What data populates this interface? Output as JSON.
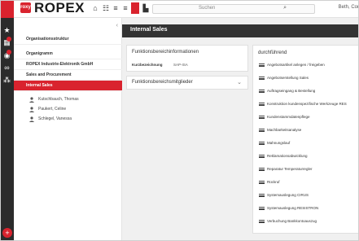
{
  "topbar": {
    "logo_badge": "roxy",
    "logo_text": "ROPEX",
    "icons": [
      "home-icon",
      "list-icon",
      "menu-icon",
      "menu-icon",
      "org-icon",
      "chart-icon"
    ],
    "search_placeholder": "Suchen",
    "user_name": "Beth, Cor"
  },
  "rail": {
    "icons": [
      "star-icon",
      "grid-icon",
      "people-icon",
      "infinity-icon",
      "network-icon"
    ],
    "add_label": "+"
  },
  "nav": {
    "items": [
      {
        "label": "Organisationsstruktur",
        "active": false
      },
      {
        "label": "Organigramm",
        "active": false
      },
      {
        "label": "ROPEX Industrie-Elektronik GmbH",
        "active": false
      },
      {
        "label": "Sales and Procurement",
        "active": false
      },
      {
        "label": "Internal Sales",
        "active": true
      }
    ],
    "people": [
      "Kutschbauch, Thomas",
      "Paukert, Celine",
      "Schlegel, Vanessa"
    ]
  },
  "main": {
    "title": "Internal Sales",
    "info_card": {
      "title": "Funktionsbereichinformationen",
      "label": "Kurzbezeichnung",
      "value": "SAP-ISA"
    },
    "members_card": {
      "title": "Funktionsbereichsmitglieder"
    },
    "tasks_card": {
      "title": "durchführend",
      "items": [
        "Angebotsartikel anlegen / freigeben",
        "Angebotserstellung Sales",
        "Auftragseingang & Bestellung",
        "Konstruktion kundenspezifische Werkzeuge RES",
        "Kundenstammdatenpflege",
        "Machbarkeitsanalyse",
        "Mahnungslauf",
        "Reklamationsabwicklung",
        "Reparatur Temperaturregler",
        "Rückruf",
        "Systemauslegung CIRUS",
        "Systemauslegung RESISTRON",
        "Verbuchung Bankkontoauszug"
      ]
    }
  },
  "colors": {
    "accent": "#d9232e",
    "rail": "#2b2b2b",
    "header": "#333333",
    "background": "#f0f0f0"
  }
}
